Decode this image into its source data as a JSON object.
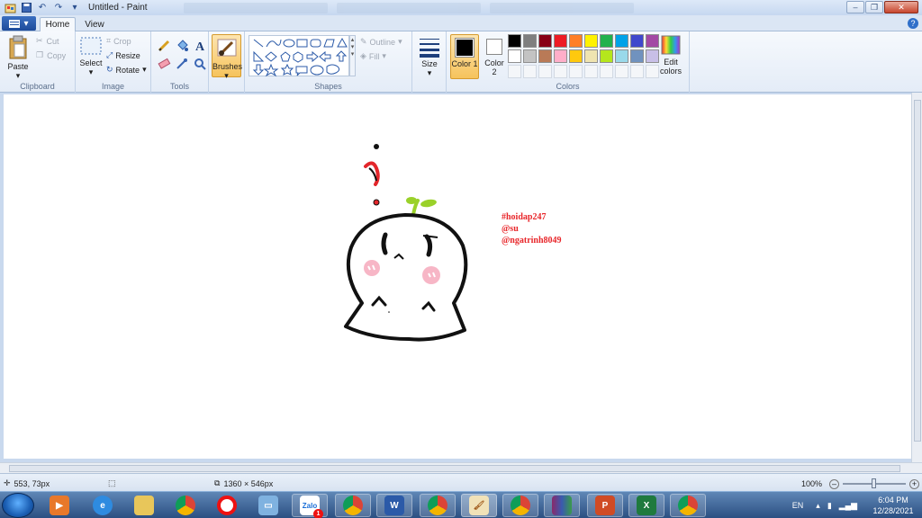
{
  "window": {
    "title": "Untitled - Paint"
  },
  "tabs": {
    "file": "",
    "home": "Home",
    "view": "View"
  },
  "ribbon": {
    "clipboard": {
      "paste": "Paste",
      "cut": "Cut",
      "copy": "Copy",
      "group": "Clipboard"
    },
    "image": {
      "select": "Select",
      "crop": "Crop",
      "resize": "Resize",
      "rotate": "Rotate",
      "group": "Image"
    },
    "tools": {
      "group": "Tools"
    },
    "brushes": {
      "label": "Brushes"
    },
    "shapes": {
      "outline": "Outline",
      "fill": "Fill",
      "group": "Shapes"
    },
    "size": {
      "label": "Size"
    },
    "colors": {
      "color1": "Color 1",
      "color1_num": "1",
      "color2": "Color",
      "color2_num": "2",
      "edit": "Edit",
      "edit2": "colors",
      "group": "Colors",
      "primary": "#000000",
      "secondary": "#ffffff",
      "palette_row1": [
        "#000000",
        "#7f7f7f",
        "#880015",
        "#ed1c24",
        "#ff7f27",
        "#fff200",
        "#22b14c",
        "#00a2e8",
        "#3f48cc",
        "#a349a4"
      ],
      "palette_row2": [
        "#ffffff",
        "#c3c3c3",
        "#b97a57",
        "#ffaec9",
        "#ffc90e",
        "#efe4b0",
        "#b5e61d",
        "#99d9ea",
        "#7092be",
        "#c8bfe7"
      ]
    }
  },
  "canvas": {
    "text_lines": [
      "#hoidap247",
      "@su",
      "@ngatrinh8049"
    ],
    "text_color": "#e8262a"
  },
  "statusbar": {
    "cursor_pos": "553, 73px",
    "canvas_size": "1360 × 546px",
    "zoom": "100%"
  },
  "taskbar": {
    "language": "EN",
    "time": "6:04 PM",
    "date": "12/28/2021",
    "apps": [
      "media",
      "ie",
      "explorer",
      "chrome",
      "opera",
      "monitor",
      "zalo",
      "chrome-profile",
      "word",
      "chrome",
      "paint",
      "chrome-n",
      "winrar",
      "powerpoint",
      "excel",
      "chrome"
    ],
    "zalo_label": "Zalo",
    "zalo_badge": "1"
  }
}
